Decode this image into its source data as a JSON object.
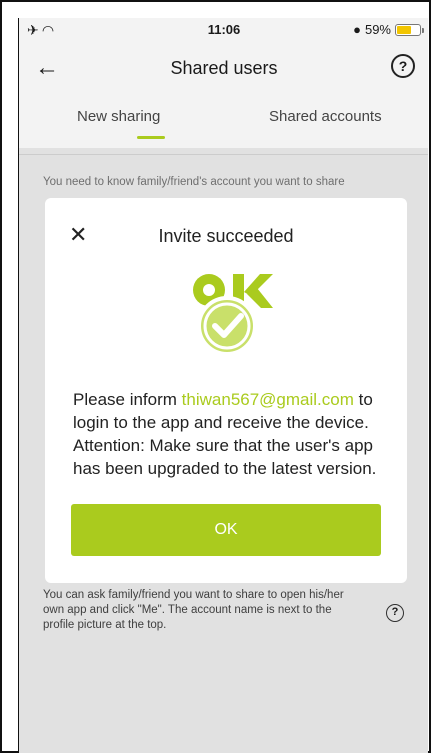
{
  "status_bar": {
    "left_icons": "✈ ◠",
    "time": "11:06",
    "battery": "59%"
  },
  "header": {
    "title": "Shared users",
    "back_icon": "arrow-left-icon",
    "help_icon": "question-circle-icon",
    "help_text": "?"
  },
  "tabs": [
    {
      "label": "New sharing",
      "active": true
    },
    {
      "label": "Shared accounts",
      "active": false
    }
  ],
  "hint_text": "You need to know family/friend's account you want to share",
  "bottom_help_text": "You can ask family/friend you want to share to open his/her own app and click \"Me\". The account name is next to the profile picture at the top.",
  "modal": {
    "close_text": "✕",
    "title": "Invite succeeded",
    "message_prefix": "Please inform ",
    "email": "thiwan567@gmail.com",
    "message_suffix": " to login to the app and receive the device. Attention: Make sure that the user's app has been upgraded to the latest version.",
    "ok_label": "OK"
  },
  "colors": {
    "accent": "#aacb1e",
    "battery_fill": "#f2c500"
  }
}
